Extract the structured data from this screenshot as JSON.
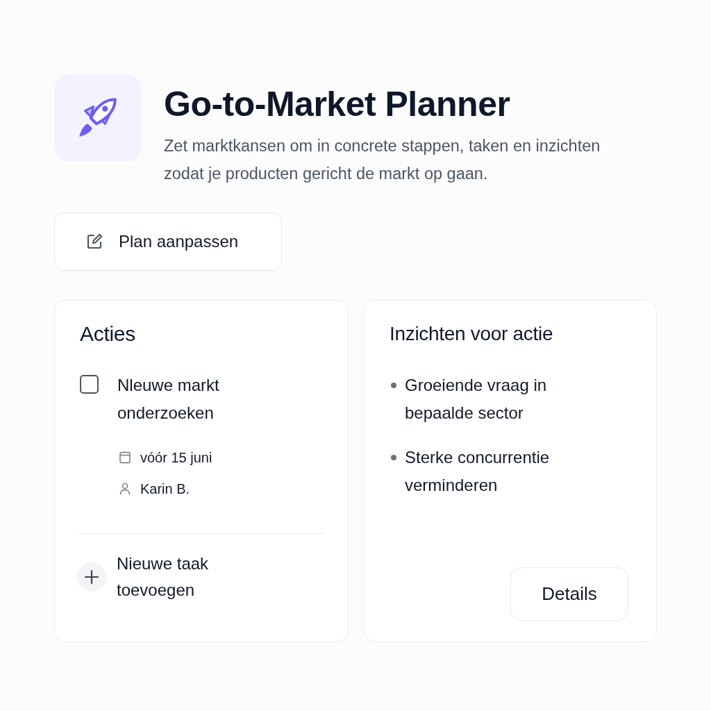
{
  "header": {
    "title": "Go-to-Market Planner",
    "subtitle": "Zet marktkansen om in concrete stappen, taken en inzichten zodat je producten gericht de markt op gaan."
  },
  "edit_button": {
    "label": "Plan aanpassen"
  },
  "actions": {
    "title": "Acties",
    "tasks": [
      {
        "label": "Nleuwe markt onderzoeken",
        "checked": false,
        "due": "vóór 15 juni",
        "assignee": "Karin B."
      }
    ],
    "add_task": "Nieuwe taak toevoegen"
  },
  "insights": {
    "title": "Inzichten voor actie",
    "items": [
      "Groeiende vraag in bepaalde sector",
      "Sterke concurrentie verminderen"
    ],
    "button": "Details"
  }
}
